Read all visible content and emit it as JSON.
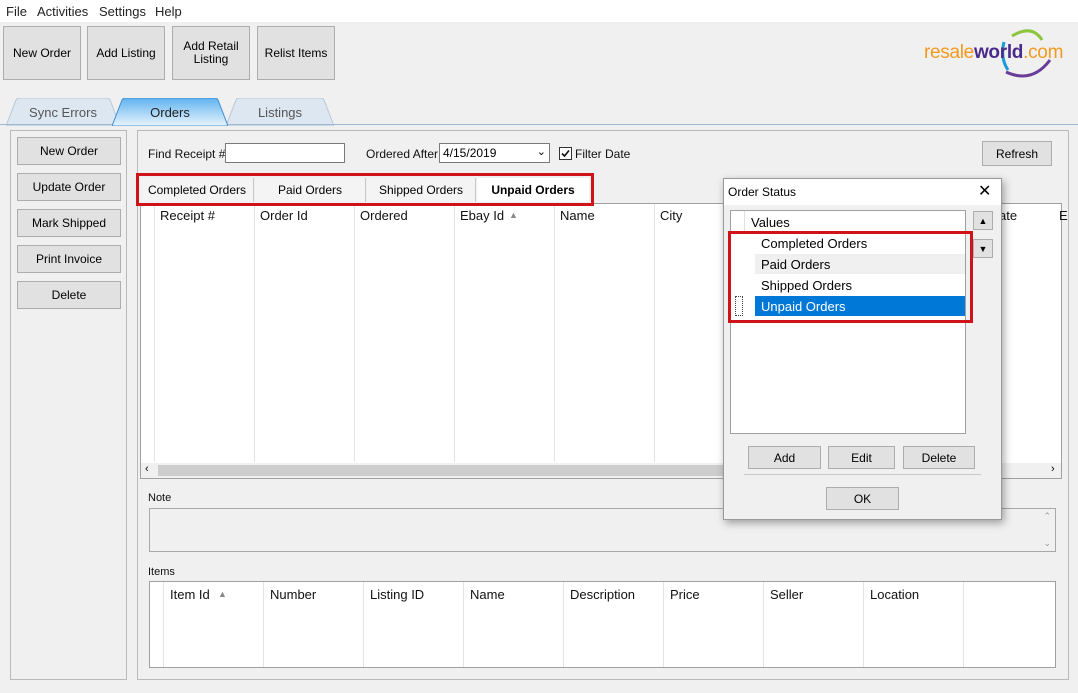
{
  "menu": [
    "File",
    "Activities",
    "Settings",
    "Help"
  ],
  "toolbar": {
    "new_order": "New Order",
    "add_listing": "Add Listing",
    "add_retail_listing": "Add Retail Listing",
    "relist_items": "Relist Items"
  },
  "logo": {
    "resale": "resale",
    "world": "world",
    "com": ".com"
  },
  "main_tabs": [
    "Sync Errors",
    "Orders",
    "Listings"
  ],
  "left_buttons": [
    "New Order",
    "Update Order",
    "Mark Shipped",
    "Print Invoice",
    "Delete"
  ],
  "search": {
    "find_receipt_label": "Find Receipt #",
    "find_receipt_value": "",
    "ordered_after_label": "Ordered After",
    "ordered_after_value": "4/15/2019",
    "filter_date_label": "Filter Date",
    "filter_date_checked": true,
    "refresh": "Refresh"
  },
  "status_tabs": [
    "Completed Orders",
    "Paid Orders",
    "Shipped Orders",
    "Unpaid Orders"
  ],
  "grid_columns": [
    "Receipt #",
    "Order Id",
    "Ordered",
    "Ebay Id",
    "Name",
    "City",
    "ate",
    "E"
  ],
  "note_label": "Note",
  "items_label": "Items",
  "items_columns": [
    "Item Id",
    "Number",
    "Listing ID",
    "Name",
    "Description",
    "Price",
    "Seller",
    "Location"
  ],
  "dialog": {
    "title": "Order Status",
    "header": "Values",
    "values": [
      "Completed Orders",
      "Paid Orders",
      "Shipped Orders",
      "Unpaid Orders"
    ],
    "selected": "Unpaid Orders",
    "add": "Add",
    "edit": "Edit",
    "delete": "Delete",
    "ok": "OK"
  },
  "colors": {
    "accent": "#0078d7",
    "highlight": "#d0121b",
    "tab_active": "#3a9be6"
  }
}
